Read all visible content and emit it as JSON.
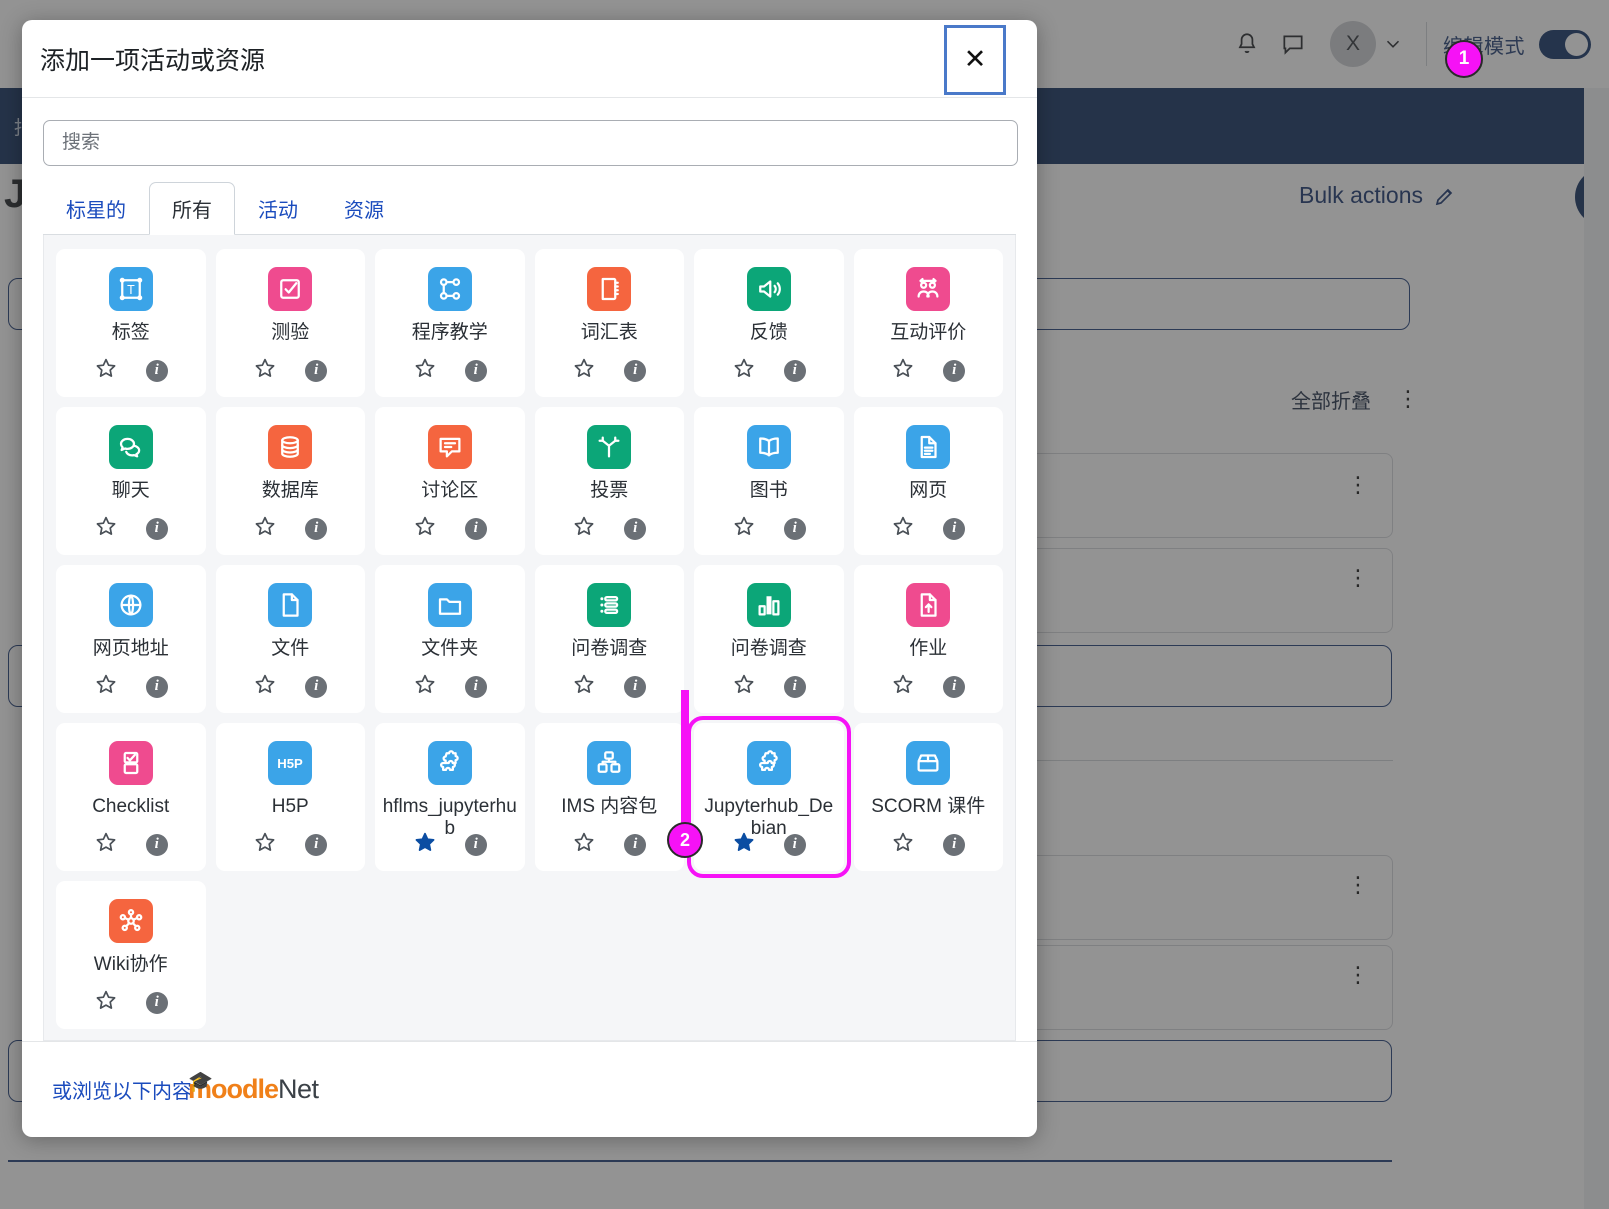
{
  "background": {
    "nav_text": "报",
    "page_title": "Ju",
    "bulk_actions_label": "Bulk actions",
    "collapse_all_label": "全部折叠",
    "topbar": {
      "bell_icon": "bell-icon",
      "chat_icon": "chat-icon",
      "avatar_initial": "X",
      "chevron_icon": "chevron-down-icon",
      "edit_mode_label": "编辑模式",
      "toggle_state": "on"
    },
    "drawer_toggle_icon": "chevron-left-icon"
  },
  "modal": {
    "title": "添加一项活动或资源",
    "close_label": "✕",
    "search": {
      "placeholder": "搜索",
      "value": ""
    },
    "tabs": [
      {
        "label": "标星的",
        "active": false
      },
      {
        "label": "所有",
        "active": true
      },
      {
        "label": "活动",
        "active": false
      },
      {
        "label": "资源",
        "active": false
      }
    ],
    "footer": {
      "link_label": "或浏览以下内容",
      "logo_primary": "moodle",
      "logo_secondary": "Net"
    },
    "items": [
      {
        "label": "标签",
        "icon": "label-icon",
        "color": "#3ba4e8",
        "starred": false
      },
      {
        "label": "测验",
        "icon": "quiz-icon",
        "color": "#ef4b8f",
        "starred": false
      },
      {
        "label": "程序教学",
        "icon": "lesson-icon",
        "color": "#3ba4e8",
        "starred": false
      },
      {
        "label": "词汇表",
        "icon": "glossary-icon",
        "color": "#f5653f",
        "starred": false
      },
      {
        "label": "反馈",
        "icon": "feedback-icon",
        "color": "#0ca678",
        "starred": false
      },
      {
        "label": "互动评价",
        "icon": "workshop-icon",
        "color": "#ef4b8f",
        "starred": false
      },
      {
        "label": "聊天",
        "icon": "chat-bubbles-icon",
        "color": "#0ca678",
        "starred": false
      },
      {
        "label": "数据库",
        "icon": "database-icon",
        "color": "#f5653f",
        "starred": false
      },
      {
        "label": "讨论区",
        "icon": "forum-icon",
        "color": "#f5653f",
        "starred": false
      },
      {
        "label": "投票",
        "icon": "choice-icon",
        "color": "#0ca678",
        "starred": false
      },
      {
        "label": "图书",
        "icon": "book-icon",
        "color": "#3ba4e8",
        "starred": false
      },
      {
        "label": "网页",
        "icon": "page-icon",
        "color": "#3ba4e8",
        "starred": false
      },
      {
        "label": "网页地址",
        "icon": "globe-icon",
        "color": "#3ba4e8",
        "starred": false
      },
      {
        "label": "文件",
        "icon": "file-icon",
        "color": "#3ba4e8",
        "starred": false
      },
      {
        "label": "文件夹",
        "icon": "folder-icon",
        "color": "#3ba4e8",
        "starred": false
      },
      {
        "label": "问卷调查",
        "icon": "questionnaire-icon",
        "color": "#0ca678",
        "starred": false
      },
      {
        "label": "问卷调查",
        "icon": "survey-chart-icon",
        "color": "#0ca678",
        "starred": false
      },
      {
        "label": "作业",
        "icon": "assignment-icon",
        "color": "#ef4b8f",
        "starred": false
      },
      {
        "label": "Checklist",
        "icon": "checklist-icon",
        "color": "#ef4b8f",
        "starred": false
      },
      {
        "label": "H5P",
        "icon": "h5p-icon",
        "color": "#3ba4e8",
        "starred": false
      },
      {
        "label": "hflms_jupyterhub",
        "icon": "puzzle-icon",
        "color": "#3ba4e8",
        "starred": true
      },
      {
        "label": "IMS 内容包",
        "icon": "ims-package-icon",
        "color": "#3ba4e8",
        "starred": false
      },
      {
        "label": "Jupyterhub_Debian",
        "icon": "puzzle-icon",
        "color": "#3ba4e8",
        "starred": true,
        "highlighted": true
      },
      {
        "label": "SCORM 课件",
        "icon": "scorm-icon",
        "color": "#3ba4e8",
        "starred": false
      },
      {
        "label": "Wiki协作",
        "icon": "wiki-network-icon",
        "color": "#f5653f",
        "starred": false
      }
    ]
  },
  "annotations": [
    {
      "number": "1",
      "target": "edit-mode-toggle"
    },
    {
      "number": "2",
      "target": "jupyterhub-debian-chip"
    }
  ],
  "colors": {
    "accent_magenta": "#f612f6",
    "brand_navy": "#0d2a5c",
    "link_blue": "#1a4bbd",
    "star_active": "#0b4da2"
  }
}
